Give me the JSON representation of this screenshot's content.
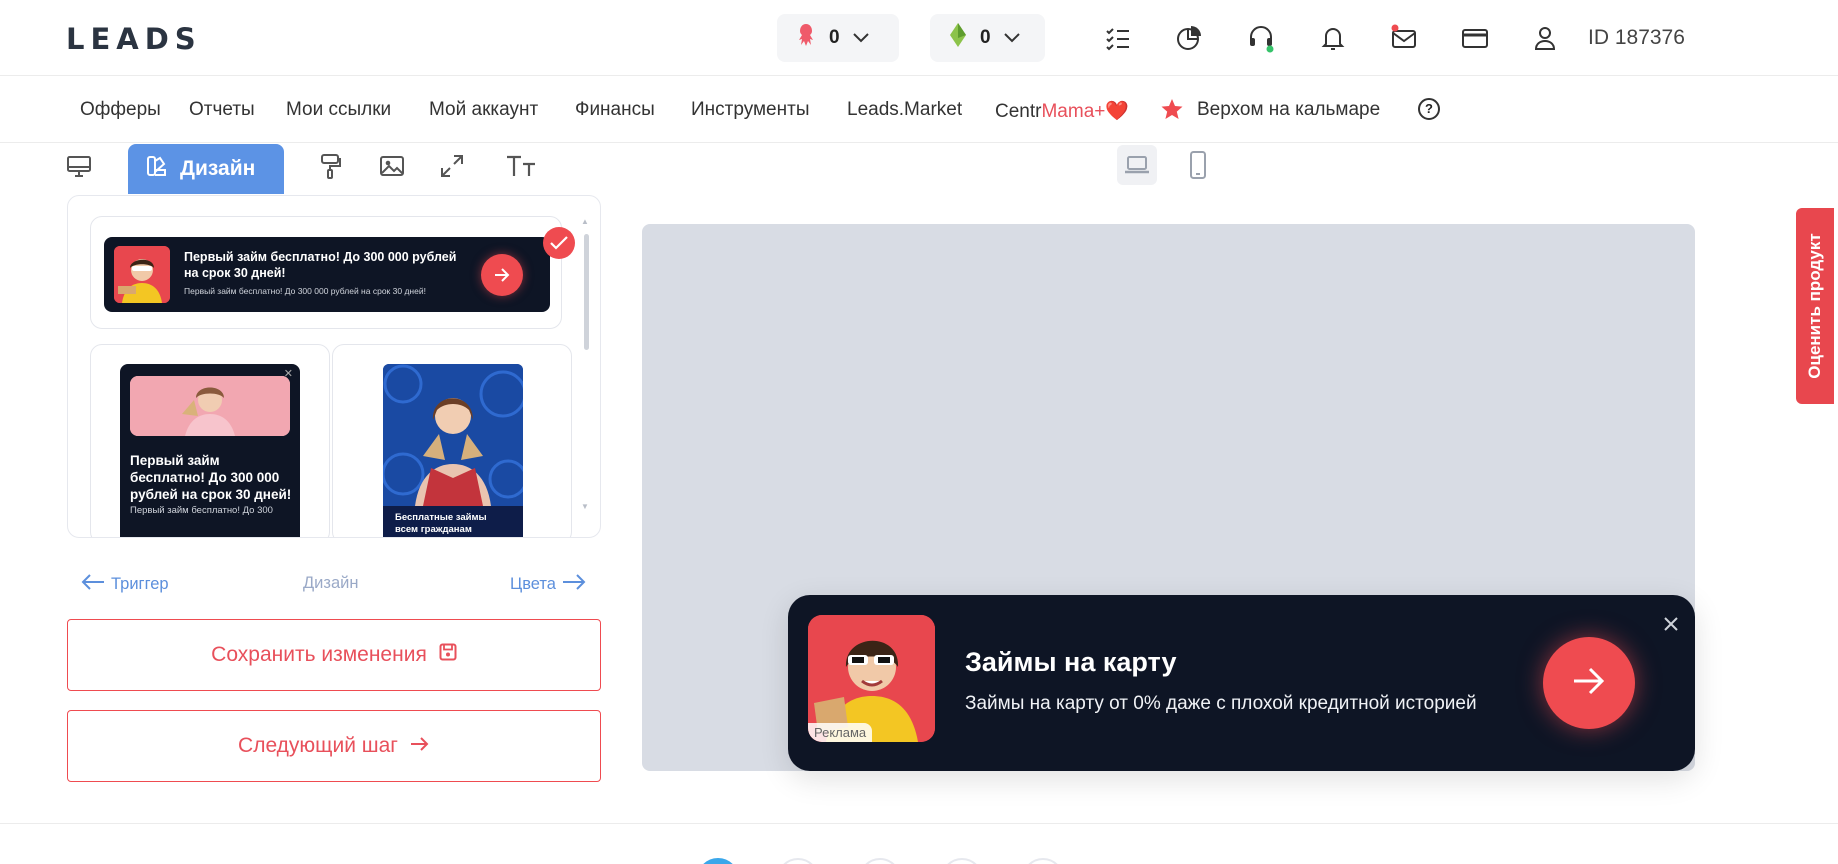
{
  "header": {
    "logo": "LEADS",
    "balance1": "0",
    "balance2": "0",
    "user_id": "ID 187376"
  },
  "nav": {
    "items": [
      "Офферы",
      "Отчеты",
      "Мои ссылки",
      "Мой аккаунт",
      "Финансы",
      "Инструменты",
      "Leads.Market"
    ],
    "centr_prefix": "Centr",
    "centr_suffix": "Mama+❤️",
    "promo": "Верхом на кальмаре",
    "help": "?"
  },
  "editor": {
    "design_tab": "Дизайн"
  },
  "templates": {
    "wide_title": "Первый займ бесплатно!  До 300 000 рублей на срок 30 дней!",
    "wide_sub": "Первый займ бесплатно!  До 300 000 рублей на срок 30 дней!",
    "card1_title": "Первый займ бесплатно!  До 300 000 рублей на срок 30 дней!",
    "card1_sub": "Первый займ бесплатно!  До 300",
    "card2_caption": "Бесплатные займы всем гражданам Российской Федерации"
  },
  "steps": {
    "prev": "Триггер",
    "current": "Дизайн",
    "next": "Цвета"
  },
  "buttons": {
    "save": "Сохранить изменения",
    "next_step": "Следующий шаг"
  },
  "preview": {
    "ad_label": "Реклама",
    "title": "Займы на карту",
    "subtitle": "Займы на карту от 0% даже с плохой кредитной историей"
  },
  "feedback": "Оценить продукт",
  "colors": {
    "accent": "#ef4b50",
    "primary_blue": "#5c93e5",
    "banner_dark": "#0e1525",
    "preview_bg": "#d8dce4"
  }
}
